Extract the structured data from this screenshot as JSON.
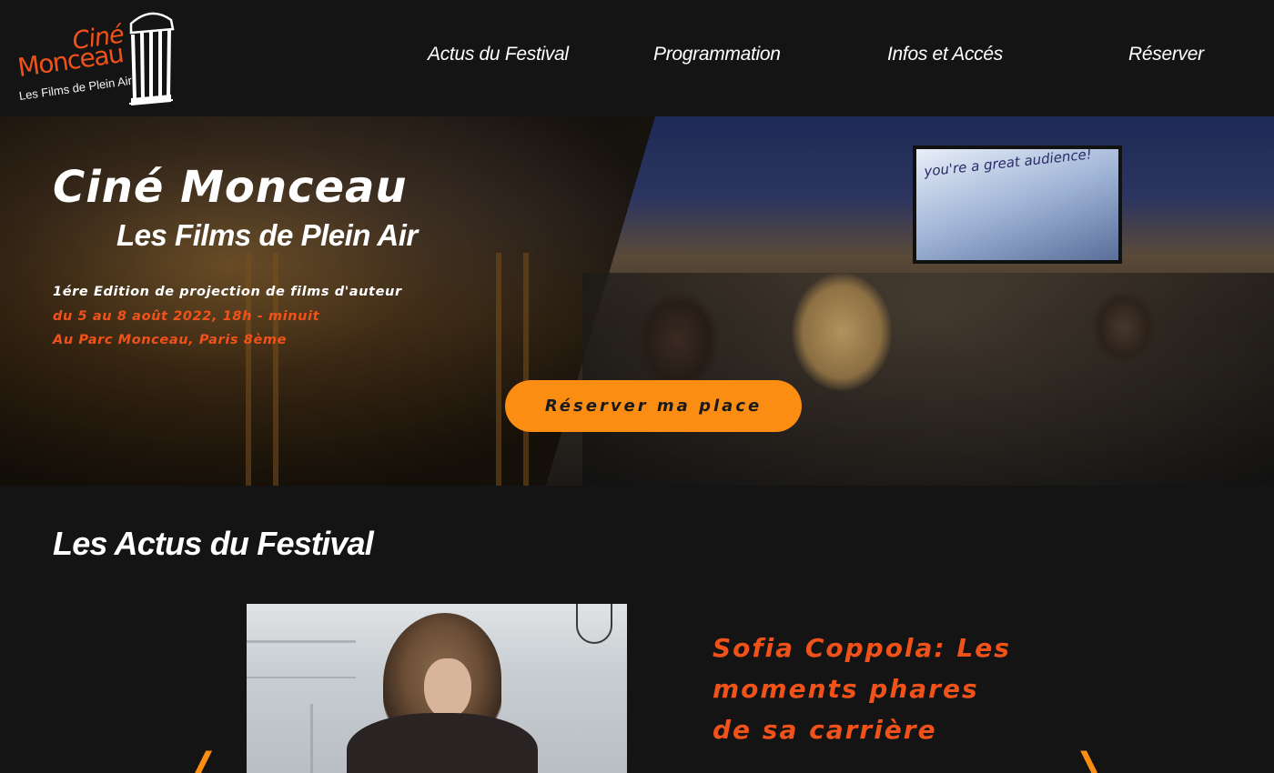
{
  "brand": {
    "logo_line1": "Ciné",
    "logo_line2": "Monceau",
    "logo_line3": "Les Films de Plein Air",
    "accent_color": "#f0521a",
    "cta_color": "#fb8e12"
  },
  "nav": {
    "items": [
      {
        "label": "Actus du Festival"
      },
      {
        "label": "Programmation"
      },
      {
        "label": "Infos et Accés"
      },
      {
        "label": "Réserver"
      }
    ]
  },
  "hero": {
    "title": "Ciné Monceau",
    "subtitle": "Les Films de Plein Air",
    "line1": "1ére Edition de projection de films d'auteur",
    "line2": "du 5 au 8 août 2022, 18h - minuit",
    "line3": "Au Parc Monceau, Paris 8ème",
    "cta_label": "Réserver ma place",
    "screen_text": "you're a great audience!"
  },
  "news": {
    "section_title": "Les Actus du Festival",
    "article_title": "Sofia Coppola: Les moments phares de sa carrière",
    "prev_icon": "chevron-left-icon",
    "next_icon": "chevron-right-icon"
  }
}
